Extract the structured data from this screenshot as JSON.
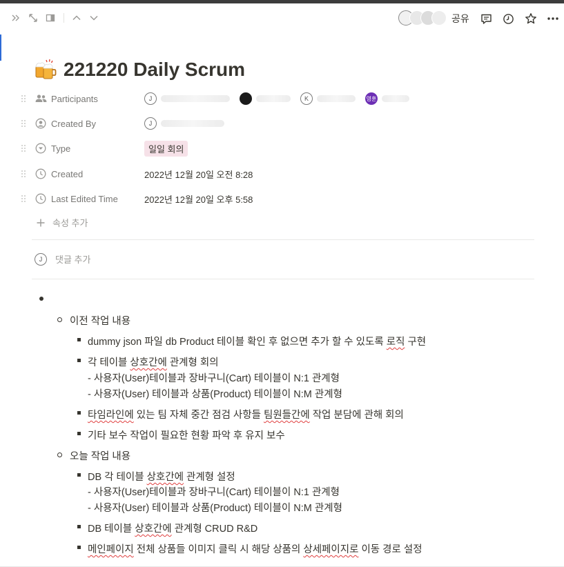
{
  "topbar": {
    "share_label": "공유",
    "left_icons": [
      "double-chevron-right-icon",
      "expand-icon",
      "side-peek-icon",
      "chevron-up-icon",
      "chevron-down-icon"
    ],
    "right_icons": [
      "comment-icon",
      "clock-icon",
      "star-icon",
      "more-icon"
    ]
  },
  "page": {
    "icon": "beer-mugs-emoji",
    "title": "221220 Daily Scrum"
  },
  "properties": {
    "participants": {
      "label": "Participants",
      "people": [
        {
          "initial": "J"
        },
        {
          "initial": ""
        },
        {
          "initial": "K"
        },
        {
          "initial": "영훈"
        }
      ]
    },
    "created_by": {
      "label": "Created By",
      "initial": "J"
    },
    "type": {
      "label": "Type",
      "value": "일일 회의",
      "color": "#f6e1e8"
    },
    "created": {
      "label": "Created",
      "value": "2022년 12월 20일 오전 8:28"
    },
    "last_edited": {
      "label": "Last Edited Time",
      "value": "2022년 12월 20일 오후 5:58"
    },
    "add_property": "속성 추가"
  },
  "comment": {
    "initial": "J",
    "placeholder": "댓글 추가"
  },
  "content": {
    "section1": {
      "heading": "이전 작업 내용",
      "items": [
        {
          "line1_a": "dummy json 파일 db Product 테이블 확인 후 없으면 추가 할 수 있도록 ",
          "line1_b": "로직",
          "line1_c": " 구현"
        },
        {
          "line1_a": "각 테이블 ",
          "line1_b": "상호간에",
          "line1_c": " 관계형  회의",
          "line2": "- 사용자(User)테이블과 장바구니(Cart) 테이블이 N:1 관계형",
          "line3": "- 사용자(User) 테이블과 상품(Product) 테이블이 N:M 관계형"
        },
        {
          "p1": "타임라인에",
          "p2": " 있는 팀 자체 중간 점검 사항들 ",
          "p3": "팀원들간에",
          "p4": " 작업 분담에 관해 회의"
        },
        {
          "line1": "기타 보수 작업이 필요한 현황 파악 후 유지 보수"
        }
      ]
    },
    "section2": {
      "heading": "오늘 작업 내용",
      "items": [
        {
          "line1_a": "DB 각 테이블 ",
          "line1_b": "상호간에",
          "line1_c": " 관계형 설정",
          "line2": "- 사용자(User)테이블과 장바구니(Cart) 테이블이 N:1 관계형",
          "line3": "- 사용자(User) 테이블과 상품(Product) 테이블이 N:M 관계형"
        },
        {
          "line1_a": "DB 테이블 ",
          "line1_b": "상호간에",
          "line1_c": " 관계형 CRUD R&D"
        },
        {
          "p1": "메인페이지",
          "p2": " 전체 상품들 이미지 클릭 시 해당 상품의 ",
          "p3": "상세페이지로",
          "p4": " 이동 경로 설정"
        }
      ]
    }
  }
}
